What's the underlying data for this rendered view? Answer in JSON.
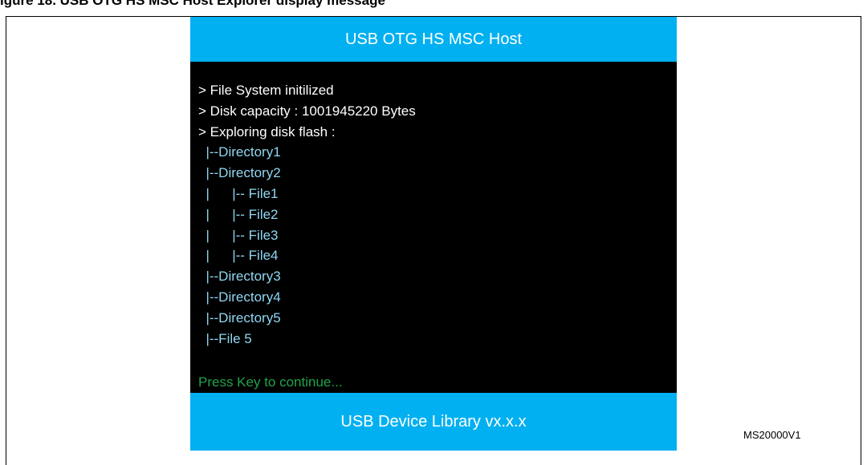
{
  "figure": {
    "caption": "igure 18. USB OTG HS MSC Host Explorer display message",
    "reference_id": "MS20000V1"
  },
  "screen": {
    "header_title": "USB OTG HS MSC Host",
    "footer_text": "USB Device Library vx.x.x",
    "status_lines": [
      "> File System initilized",
      "> Disk capacity : 1001945220 Bytes",
      "> Exploring disk flash :"
    ],
    "tree_lines": [
      "  |--Directory1",
      "  |--Directory2",
      "  |      |-- File1",
      "  |      |-- File2",
      "  |      |-- File3",
      "  |      |-- File4",
      "  |--Directory3",
      "  |--Directory4",
      "  |--Directory5",
      "  |--File 5"
    ],
    "prompt": "Press Key to continue..."
  },
  "colors": {
    "bar_blue": "#00b0f0",
    "screen_black": "#000000",
    "text_white": "#ffffff",
    "tree_cyan": "#8fd7f2",
    "prompt_green": "#1fa34a"
  }
}
